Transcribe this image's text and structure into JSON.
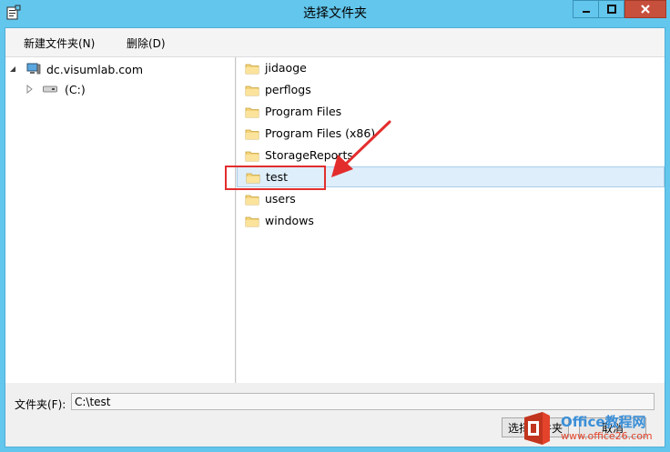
{
  "window": {
    "title": "选择文件夹",
    "accent_color": "#63c6ec",
    "close_color": "#c7503d"
  },
  "toolbar": {
    "new_folder_label": "新建文件夹(N)",
    "delete_label": "删除(D)"
  },
  "tree": {
    "root_label": "dc.visumlab.com",
    "drive_label": "(C:)"
  },
  "folders": [
    {
      "label": "jidaoge"
    },
    {
      "label": "perflogs"
    },
    {
      "label": "Program Files"
    },
    {
      "label": "Program Files (x86)"
    },
    {
      "label": "StorageReports"
    },
    {
      "label": "test",
      "selected": true
    },
    {
      "label": "users"
    },
    {
      "label": "windows"
    }
  ],
  "bottom": {
    "folder_label": "文件夹(F):",
    "folder_value": "C:\\test",
    "ok_label": "选择文件夹",
    "cancel_label": "取消"
  },
  "watermark": {
    "brand": "Office教程网",
    "url": "www.office26.com"
  },
  "annotation": {
    "highlight_color": "#e32d2d"
  }
}
